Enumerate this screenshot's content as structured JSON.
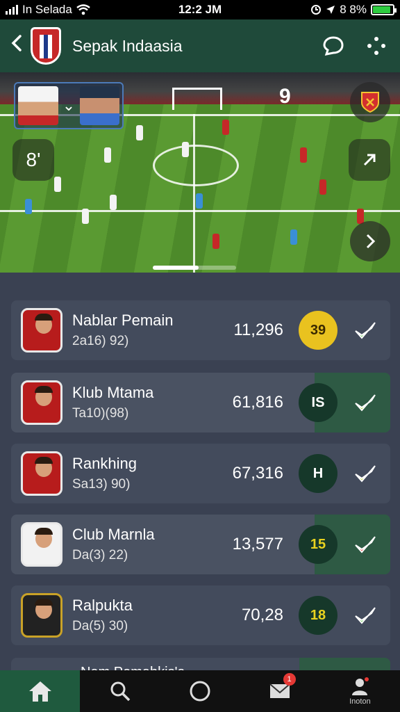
{
  "status_bar": {
    "carrier": "In Selada",
    "time": "12:2 JM",
    "battery": "8 8%",
    "battery_level": 0.88
  },
  "header": {
    "title": "Sepak Indaasia",
    "back_icon": "chevron-left-icon",
    "chat_icon": "chat-bubble-icon",
    "more_icon": "more-dots-icon"
  },
  "video": {
    "score": "9",
    "left_button": "8'",
    "progress": 0.55,
    "icons": [
      "chevron-down-icon",
      "team-crest-icon",
      "expand-icon",
      "chevron-right-icon"
    ]
  },
  "list": {
    "items": [
      {
        "name": "Nablar Pemain",
        "sub": "2a16) 92)",
        "value": "11,296",
        "badge": "39",
        "badge_color": "#e9c21f",
        "badge_text_color": "#3a2a00",
        "check_color": "#5bc24b"
      },
      {
        "name": "Klub Mtama",
        "sub": "Ta10)(98)",
        "value": "61,816",
        "badge": "IS",
        "badge_color": "#16382a",
        "badge_text_color": "#ffffff",
        "check_color": "#9fd23a"
      },
      {
        "name": "Rankhing",
        "sub": "Sa13) 90)",
        "value": "67,316",
        "badge": "H",
        "badge_color": "#16382a",
        "badge_text_color": "#ffffff",
        "check_color": "#b7d23a"
      },
      {
        "name": "Club Marnla",
        "sub": "Da(3) 22)",
        "value": "13,577",
        "badge": "15",
        "badge_color": "#16382a",
        "badge_text_color": "#e9d21f",
        "check_color": "#e53935"
      },
      {
        "name": "Ralpukta",
        "sub": "Da(5) 30)",
        "value": "70,28",
        "badge": "18",
        "badge_color": "#16382a",
        "badge_text_color": "#e9d21f",
        "check_color": "#5bc24b"
      }
    ],
    "partial_label": "Nam Pemahkis'a"
  },
  "nav": {
    "items": [
      {
        "icon": "home-icon",
        "label": ""
      },
      {
        "icon": "search-icon",
        "label": ""
      },
      {
        "icon": "circle-icon",
        "label": ""
      },
      {
        "icon": "mail-icon",
        "label": "",
        "badge": "1"
      },
      {
        "icon": "user-settings-icon",
        "label": "Inoton"
      }
    ]
  }
}
